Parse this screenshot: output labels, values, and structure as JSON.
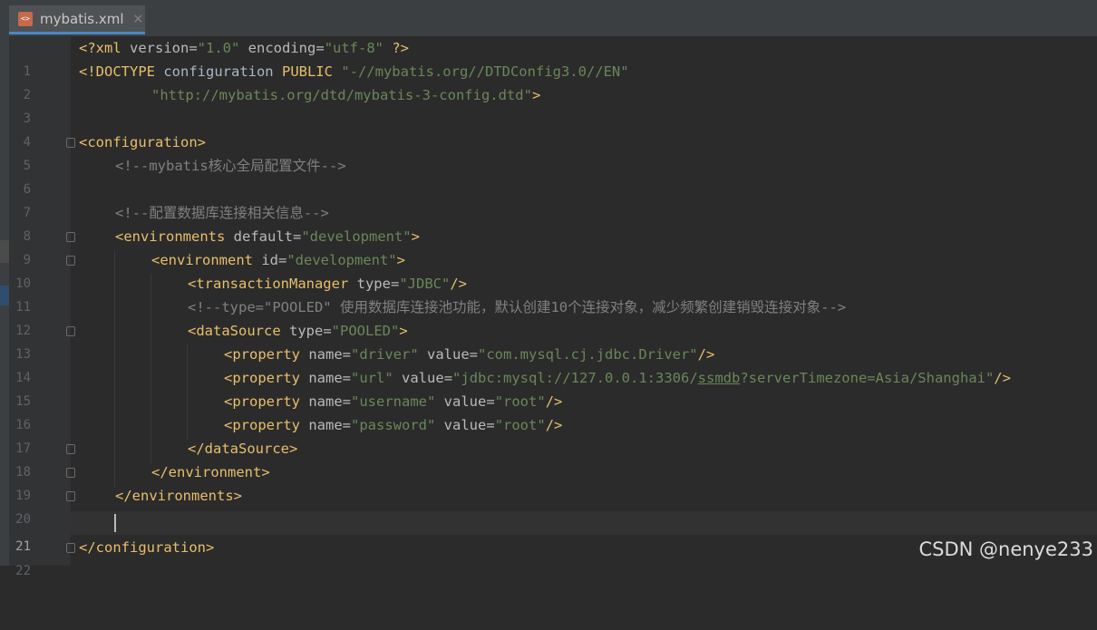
{
  "tab": {
    "filename": "mybatis.xml",
    "close": "×"
  },
  "lines": [
    {
      "n": "1"
    },
    {
      "n": "2"
    },
    {
      "n": "3"
    },
    {
      "n": "4"
    },
    {
      "n": "5"
    },
    {
      "n": "6"
    },
    {
      "n": "7"
    },
    {
      "n": "8"
    },
    {
      "n": "9"
    },
    {
      "n": "10"
    },
    {
      "n": "11"
    },
    {
      "n": "12"
    },
    {
      "n": "13"
    },
    {
      "n": "14"
    },
    {
      "n": "15"
    },
    {
      "n": "16"
    },
    {
      "n": "17"
    },
    {
      "n": "18"
    },
    {
      "n": "19"
    },
    {
      "n": "20"
    },
    {
      "n": "21"
    },
    {
      "n": "22"
    }
  ],
  "code": {
    "l1": [
      "<?xml ",
      "version",
      "=",
      "\"1.0\"",
      " encoding",
      "=",
      "\"utf-8\"",
      " ?>"
    ],
    "l2a": "<!DOCTYPE ",
    "l2b": "configuration ",
    "l2c": "PUBLIC ",
    "l2d": "\"-//mybatis.org//DTDConfig3.0//EN\"",
    "l3": "\"http://mybatis.org/dtd/mybatis-3-config.dtd\"",
    "l3end": ">",
    "l5": "<configuration>",
    "l6": "<!--mybatis核心全局配置文件-->",
    "l8": "<!--配置数据库连接相关信息-->",
    "l9": {
      "tag": "<environments",
      "attr": " default",
      "eq": "=",
      "val": "\"development\"",
      "end": ">"
    },
    "l10": {
      "tag": "<environment",
      "attr": " id",
      "eq": "=",
      "val": "\"development\"",
      "end": ">"
    },
    "l11": {
      "tag": "<transactionManager",
      "attr": " type",
      "eq": "=",
      "val": "\"JDBC\"",
      "end": "/>"
    },
    "l12": "<!--type=\"POOLED\" 使用数据库连接池功能，默认创建10个连接对象，减少频繁创建销毁连接对象-->",
    "l13": {
      "tag": "<dataSource",
      "attr": " type",
      "eq": "=",
      "val": "\"POOLED\"",
      "end": ">"
    },
    "l14": {
      "tag": "<property",
      "a1": " name",
      "v1": "\"driver\"",
      "a2": " value",
      "v2": "\"com.mysql.cj.jdbc.Driver\"",
      "end": "/>"
    },
    "l15": {
      "tag": "<property",
      "a1": " name",
      "v1": "\"url\"",
      "a2": " value",
      "v2a": "\"jdbc:mysql://127.0.0.1:3306/",
      "v2b": "ssmdb",
      "v2c": "?serverTimezone=Asia/Shanghai\"",
      "end": "/>"
    },
    "l16": {
      "tag": "<property",
      "a1": " name",
      "v1": "\"username\"",
      "a2": " value",
      "v2": "\"root\"",
      "end": "/>"
    },
    "l17": {
      "tag": "<property",
      "a1": " name",
      "v1": "\"password\"",
      "a2": " value",
      "v2": "\"root\"",
      "end": "/>"
    },
    "l18": "</dataSource>",
    "l19": "</environment>",
    "l20": "</environments>",
    "l22": "</configuration>"
  },
  "watermark": "CSDN @nenye233"
}
